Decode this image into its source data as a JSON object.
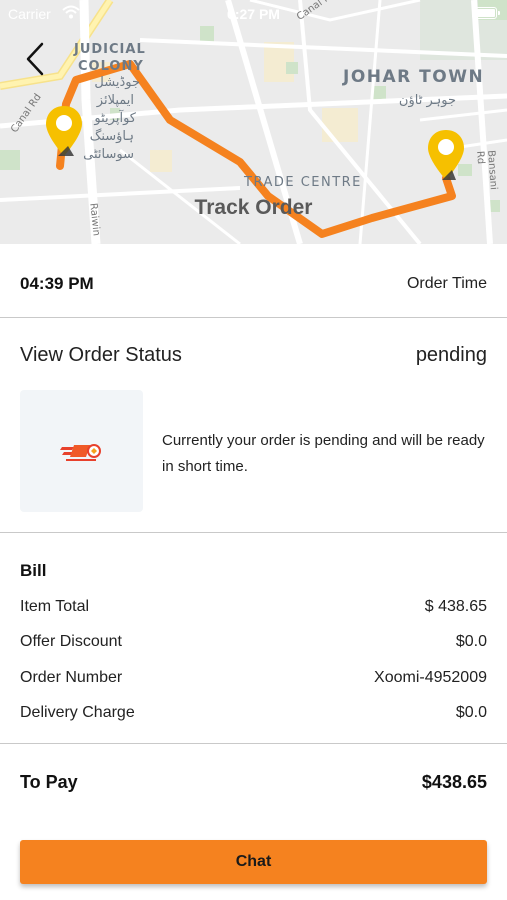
{
  "status_bar": {
    "carrier": "Carrier",
    "time": "6:27 PM"
  },
  "map": {
    "title": "Track Order",
    "places": {
      "judicial_colony_line1": "JUDICIAL",
      "judicial_colony_line2": "COLONY",
      "johar_town": "JOHAR TOWN",
      "trade_centre": "TRADE CENTRE"
    },
    "urdu_labels": {
      "judicial_colony_urdu_1": "جوڈیشل",
      "judicial_colony_urdu_2": "ایمپلائز",
      "judicial_colony_urdu_3": "کوآپریٹو",
      "judicial_colony_urdu_4": "ہاؤسنگ",
      "judicial_colony_urdu_5": "سوسائٹی",
      "johar_town_urdu": "جوہر ٹاؤن"
    },
    "roads": {
      "canal_rd_left": "Canal Rd",
      "canal_rd_top": "Canal Rd",
      "raiwind": "Raiwin",
      "bansani_rd": "Bansani Rd"
    },
    "colors": {
      "route": "#f5821f",
      "pin": "#f6c000"
    }
  },
  "order": {
    "time_value": "04:39 PM",
    "time_label": "Order Time",
    "status_heading": "View Order Status",
    "status_value": "pending",
    "status_message": "Currently your order is pending and will be ready in short time."
  },
  "bill": {
    "title": "Bill",
    "lines": [
      {
        "label": "Item Total",
        "value": "$ 438.65"
      },
      {
        "label": "Offer Discount",
        "value": "$0.0"
      },
      {
        "label": "Order Number",
        "value": "Xoomi-4952009"
      },
      {
        "label": "Delivery Charge",
        "value": "$0.0"
      }
    ],
    "to_pay_label": "To Pay",
    "to_pay_value": "$438.65"
  },
  "actions": {
    "chat_label": "Chat"
  },
  "colors": {
    "accent": "#f5821f",
    "divider": "#c9c9c9",
    "logo_bg": "#f2f5f8"
  }
}
